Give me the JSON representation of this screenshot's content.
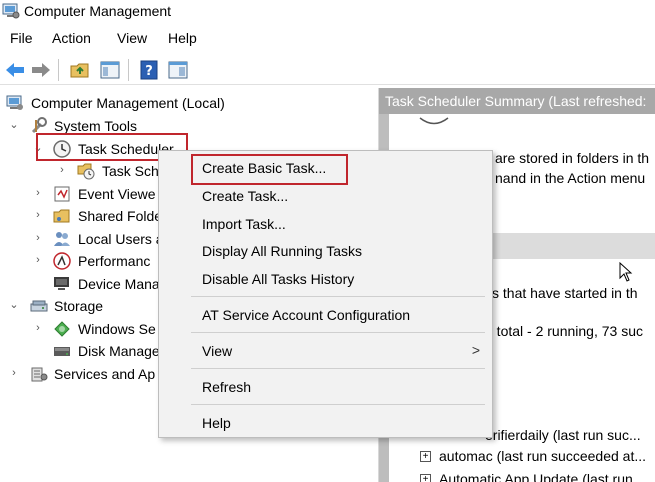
{
  "window": {
    "title": "Computer Management"
  },
  "menubar": [
    "File",
    "Action",
    "View",
    "Help"
  ],
  "toolbar": {
    "buttons": [
      "back-arrow-icon",
      "forward-arrow-icon",
      "up-folder-icon",
      "show-hide-tree-icon",
      "help-icon",
      "properties-icon"
    ]
  },
  "tree": {
    "root": "Computer Management (Local)",
    "system_tools": "System Tools",
    "task_scheduler": "Task Scheduler",
    "task_scheduler_library": "Task Sch",
    "event_viewer": "Event Viewe",
    "shared_folders": "Shared Folde",
    "local_users": "Local Users a",
    "performance": "Performanc",
    "device_manager": "Device Mana",
    "storage": "Storage",
    "windows_server_backup": "Windows Se",
    "disk_management": "Disk Manage",
    "services_and_apps": "Services and Ap"
  },
  "right_pane": {
    "header": "Task Scheduler Summary (Last refreshed:",
    "line1": "are stored in folders in th",
    "line2": "nand in the Action menu",
    "line3": "ks that have started in th",
    "line4": "5 total - 2 running, 73 suc",
    "task1": "erifierdaily (last run suc...",
    "task2": "automac (last run succeeded at...",
    "task3": "Automatic App Update (last run..."
  },
  "context_menu": {
    "items": [
      "Create Basic Task...",
      "Create Task...",
      "Import Task...",
      "Display All Running Tasks",
      "Disable All Tasks History",
      "AT Service Account Configuration",
      "View",
      "Refresh",
      "Help"
    ],
    "submenu_arrow": ">"
  },
  "colors": {
    "highlight": "#c0262d",
    "header_bg": "#a8a8a8",
    "menu_bg": "#f2f2f2"
  }
}
